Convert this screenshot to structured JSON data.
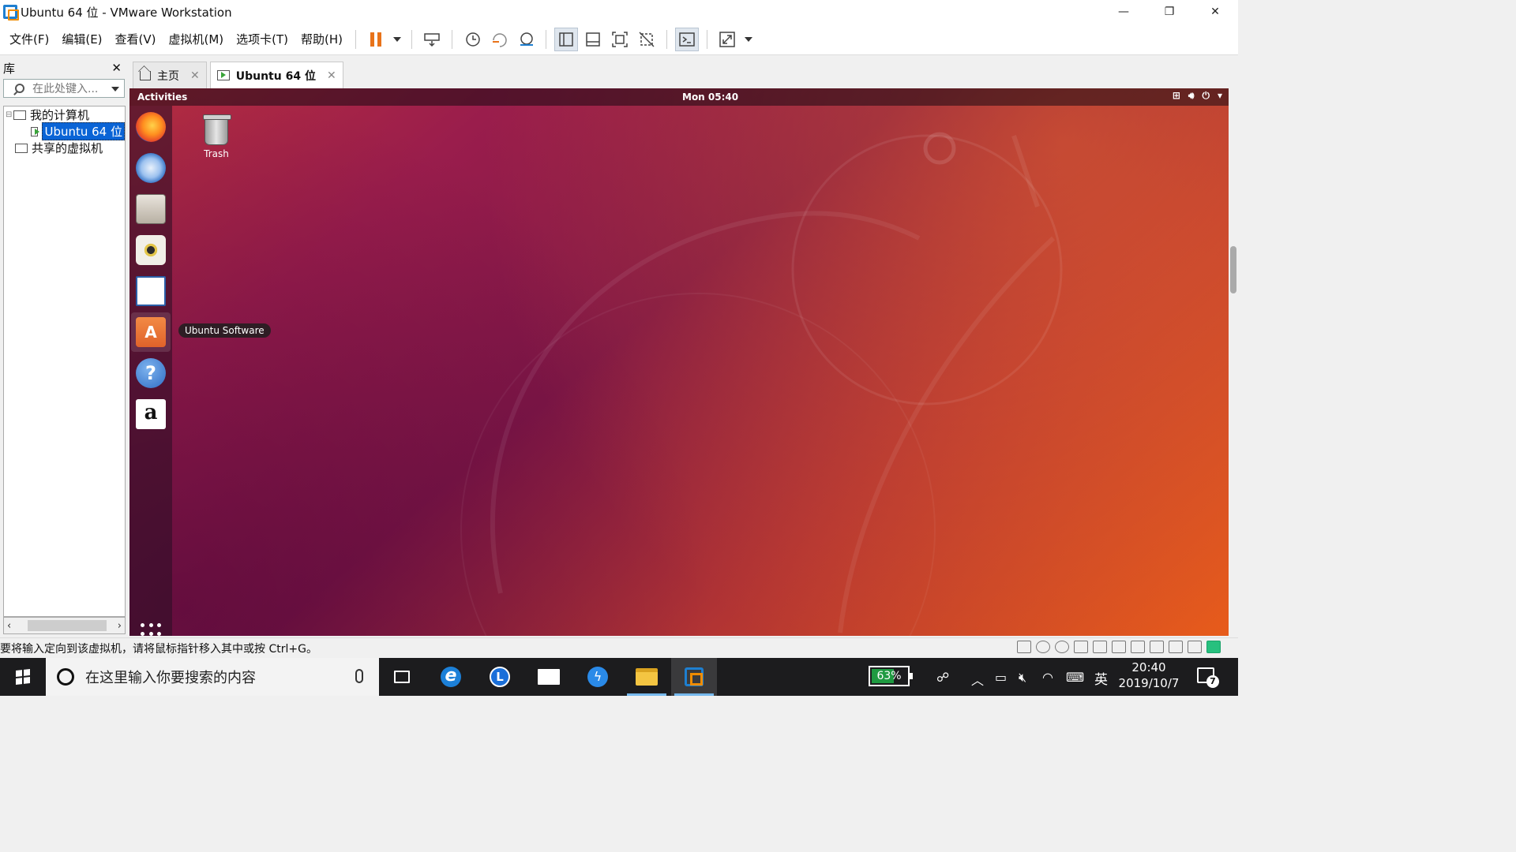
{
  "window": {
    "title": "Ubuntu 64 位 - VMware Workstation"
  },
  "menu": [
    "文件(F)",
    "编辑(E)",
    "查看(V)",
    "虚拟机(M)",
    "选项卡(T)",
    "帮助(H)"
  ],
  "library": {
    "title": "库",
    "search_placeholder": "在此处键入...",
    "tree": {
      "root": "我的计算机",
      "vm": "Ubuntu 64 位",
      "shared": "共享的虚拟机"
    }
  },
  "tabs": [
    {
      "label": "主页",
      "icon": "home-icon"
    },
    {
      "label": "Ubuntu 64 位",
      "icon": "vm-icon",
      "active": true
    }
  ],
  "guest": {
    "activities": "Activities",
    "clock": "Mon 05:40",
    "desktop_icon": "Trash",
    "tooltip": "Ubuntu Software",
    "dock": [
      "firefox-icon",
      "thunderbird-icon",
      "files-icon",
      "rhythmbox-icon",
      "writer-icon",
      "ubuntu-software-icon",
      "help-icon",
      "amazon-icon"
    ]
  },
  "status": {
    "message": "要将输入定向到该虚拟机，请将鼠标指针移入其中或按 Ctrl+G。"
  },
  "taskbar": {
    "search_placeholder": "在这里输入你要搜索的内容",
    "battery": "63%",
    "battery_level": 0.63,
    "ime": "英",
    "time": "20:40",
    "date": "2019/10/7",
    "notification_count": "7"
  },
  "colors": {
    "vmware_blue": "#1e7fd0",
    "vmware_orange": "#f08c00",
    "ubuntu_orange": "#e95420",
    "taskbar": "#1c1c1e"
  }
}
